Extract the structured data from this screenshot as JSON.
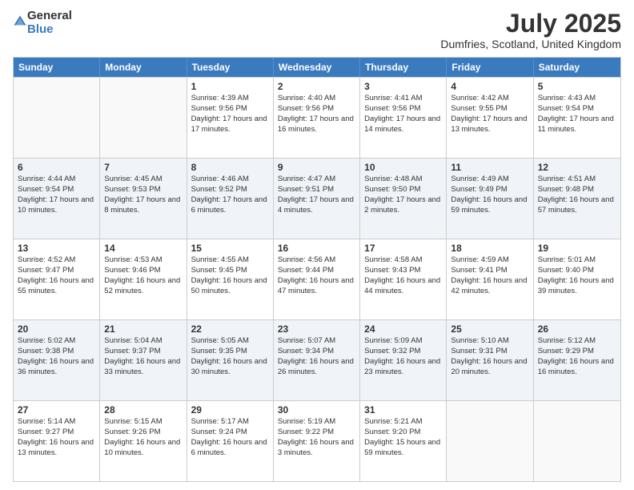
{
  "logo": {
    "general": "General",
    "blue": "Blue"
  },
  "header": {
    "title": "July 2025",
    "subtitle": "Dumfries, Scotland, United Kingdom"
  },
  "days": [
    "Sunday",
    "Monday",
    "Tuesday",
    "Wednesday",
    "Thursday",
    "Friday",
    "Saturday"
  ],
  "rows": [
    [
      {
        "day": "",
        "info": ""
      },
      {
        "day": "",
        "info": ""
      },
      {
        "day": "1",
        "info": "Sunrise: 4:39 AM\nSunset: 9:56 PM\nDaylight: 17 hours and 17 minutes."
      },
      {
        "day": "2",
        "info": "Sunrise: 4:40 AM\nSunset: 9:56 PM\nDaylight: 17 hours and 16 minutes."
      },
      {
        "day": "3",
        "info": "Sunrise: 4:41 AM\nSunset: 9:56 PM\nDaylight: 17 hours and 14 minutes."
      },
      {
        "day": "4",
        "info": "Sunrise: 4:42 AM\nSunset: 9:55 PM\nDaylight: 17 hours and 13 minutes."
      },
      {
        "day": "5",
        "info": "Sunrise: 4:43 AM\nSunset: 9:54 PM\nDaylight: 17 hours and 11 minutes."
      }
    ],
    [
      {
        "day": "6",
        "info": "Sunrise: 4:44 AM\nSunset: 9:54 PM\nDaylight: 17 hours and 10 minutes."
      },
      {
        "day": "7",
        "info": "Sunrise: 4:45 AM\nSunset: 9:53 PM\nDaylight: 17 hours and 8 minutes."
      },
      {
        "day": "8",
        "info": "Sunrise: 4:46 AM\nSunset: 9:52 PM\nDaylight: 17 hours and 6 minutes."
      },
      {
        "day": "9",
        "info": "Sunrise: 4:47 AM\nSunset: 9:51 PM\nDaylight: 17 hours and 4 minutes."
      },
      {
        "day": "10",
        "info": "Sunrise: 4:48 AM\nSunset: 9:50 PM\nDaylight: 17 hours and 2 minutes."
      },
      {
        "day": "11",
        "info": "Sunrise: 4:49 AM\nSunset: 9:49 PM\nDaylight: 16 hours and 59 minutes."
      },
      {
        "day": "12",
        "info": "Sunrise: 4:51 AM\nSunset: 9:48 PM\nDaylight: 16 hours and 57 minutes."
      }
    ],
    [
      {
        "day": "13",
        "info": "Sunrise: 4:52 AM\nSunset: 9:47 PM\nDaylight: 16 hours and 55 minutes."
      },
      {
        "day": "14",
        "info": "Sunrise: 4:53 AM\nSunset: 9:46 PM\nDaylight: 16 hours and 52 minutes."
      },
      {
        "day": "15",
        "info": "Sunrise: 4:55 AM\nSunset: 9:45 PM\nDaylight: 16 hours and 50 minutes."
      },
      {
        "day": "16",
        "info": "Sunrise: 4:56 AM\nSunset: 9:44 PM\nDaylight: 16 hours and 47 minutes."
      },
      {
        "day": "17",
        "info": "Sunrise: 4:58 AM\nSunset: 9:43 PM\nDaylight: 16 hours and 44 minutes."
      },
      {
        "day": "18",
        "info": "Sunrise: 4:59 AM\nSunset: 9:41 PM\nDaylight: 16 hours and 42 minutes."
      },
      {
        "day": "19",
        "info": "Sunrise: 5:01 AM\nSunset: 9:40 PM\nDaylight: 16 hours and 39 minutes."
      }
    ],
    [
      {
        "day": "20",
        "info": "Sunrise: 5:02 AM\nSunset: 9:38 PM\nDaylight: 16 hours and 36 minutes."
      },
      {
        "day": "21",
        "info": "Sunrise: 5:04 AM\nSunset: 9:37 PM\nDaylight: 16 hours and 33 minutes."
      },
      {
        "day": "22",
        "info": "Sunrise: 5:05 AM\nSunset: 9:35 PM\nDaylight: 16 hours and 30 minutes."
      },
      {
        "day": "23",
        "info": "Sunrise: 5:07 AM\nSunset: 9:34 PM\nDaylight: 16 hours and 26 minutes."
      },
      {
        "day": "24",
        "info": "Sunrise: 5:09 AM\nSunset: 9:32 PM\nDaylight: 16 hours and 23 minutes."
      },
      {
        "day": "25",
        "info": "Sunrise: 5:10 AM\nSunset: 9:31 PM\nDaylight: 16 hours and 20 minutes."
      },
      {
        "day": "26",
        "info": "Sunrise: 5:12 AM\nSunset: 9:29 PM\nDaylight: 16 hours and 16 minutes."
      }
    ],
    [
      {
        "day": "27",
        "info": "Sunrise: 5:14 AM\nSunset: 9:27 PM\nDaylight: 16 hours and 13 minutes."
      },
      {
        "day": "28",
        "info": "Sunrise: 5:15 AM\nSunset: 9:26 PM\nDaylight: 16 hours and 10 minutes."
      },
      {
        "day": "29",
        "info": "Sunrise: 5:17 AM\nSunset: 9:24 PM\nDaylight: 16 hours and 6 minutes."
      },
      {
        "day": "30",
        "info": "Sunrise: 5:19 AM\nSunset: 9:22 PM\nDaylight: 16 hours and 3 minutes."
      },
      {
        "day": "31",
        "info": "Sunrise: 5:21 AM\nSunset: 9:20 PM\nDaylight: 15 hours and 59 minutes."
      },
      {
        "day": "",
        "info": ""
      },
      {
        "day": "",
        "info": ""
      }
    ]
  ]
}
